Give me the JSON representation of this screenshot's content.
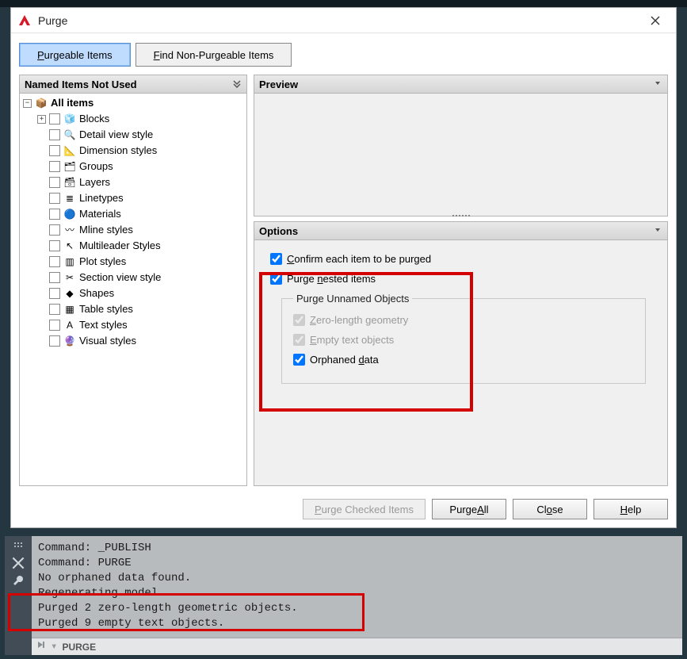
{
  "dialog": {
    "title": "Purge",
    "tabs": {
      "purgeable": {
        "pre": "",
        "u": "P",
        "post": "urgeable Items"
      },
      "nonpurgeable": {
        "pre": "",
        "u": "F",
        "post": "ind Non-Purgeable Items"
      }
    },
    "left_header": "Named Items Not Used",
    "preview_header": "Preview",
    "options_header": "Options"
  },
  "tree": {
    "root": "All items",
    "items": [
      {
        "label": "Blocks",
        "icon": "block-icon",
        "expandable": true
      },
      {
        "label": "Detail view style",
        "icon": "detailview-icon"
      },
      {
        "label": "Dimension styles",
        "icon": "dimension-icon"
      },
      {
        "label": "Groups",
        "icon": "groups-icon"
      },
      {
        "label": "Layers",
        "icon": "layers-icon"
      },
      {
        "label": "Linetypes",
        "icon": "linetypes-icon"
      },
      {
        "label": "Materials",
        "icon": "materials-icon"
      },
      {
        "label": "Mline styles",
        "icon": "mline-icon"
      },
      {
        "label": "Multileader Styles",
        "icon": "multileader-icon"
      },
      {
        "label": "Plot styles",
        "icon": "plot-icon"
      },
      {
        "label": "Section view style",
        "icon": "section-icon"
      },
      {
        "label": "Shapes",
        "icon": "shapes-icon"
      },
      {
        "label": "Table styles",
        "icon": "table-icon"
      },
      {
        "label": "Text styles",
        "icon": "text-icon"
      },
      {
        "label": "Visual styles",
        "icon": "visual-icon"
      }
    ]
  },
  "options": {
    "confirm": {
      "pre": "",
      "u": "C",
      "post": "onfirm each item to be purged",
      "checked": true,
      "enabled": true
    },
    "nested": {
      "pre": "Purge ",
      "u": "n",
      "post": "ested items",
      "checked": true,
      "enabled": true
    },
    "group_legend": "Purge Unnamed Objects",
    "zero": {
      "pre": "",
      "u": "Z",
      "post": "ero-length geometry",
      "checked": true,
      "enabled": false
    },
    "empty": {
      "pre": "",
      "u": "E",
      "post": "mpty text objects",
      "checked": true,
      "enabled": false
    },
    "orphan": {
      "pre": "Orphaned ",
      "u": "d",
      "post": "ata",
      "checked": true,
      "enabled": true
    }
  },
  "buttons": {
    "purge_checked": {
      "pre": "",
      "u": "P",
      "post": "urge Checked Items",
      "enabled": false
    },
    "purge_all": {
      "pre": "Purge ",
      "u": "A",
      "post": "ll",
      "enabled": true
    },
    "close": {
      "pre": "Cl",
      "u": "o",
      "post": "se",
      "enabled": true
    },
    "help": {
      "pre": "",
      "u": "H",
      "post": "elp",
      "enabled": true
    }
  },
  "cmd": {
    "lines": [
      "Command: _PUBLISH",
      "Command: PURGE",
      "No orphaned data found.",
      "Regenerating model.",
      "Purged 2 zero-length geometric objects.",
      "Purged 9 empty text objects."
    ],
    "prompt": "PURGE"
  },
  "icons": {
    "block-icon": "🧊",
    "detailview-icon": "🔍",
    "dimension-icon": "📐",
    "groups-icon": "🗂",
    "layers-icon": "🗃",
    "linetypes-icon": "≣",
    "materials-icon": "🔵",
    "mline-icon": "〰",
    "multileader-icon": "↖",
    "plot-icon": "▥",
    "section-icon": "✂",
    "shapes-icon": "◆",
    "table-icon": "▦",
    "text-icon": "A",
    "visual-icon": "🔮",
    "all-icon": "📦"
  }
}
